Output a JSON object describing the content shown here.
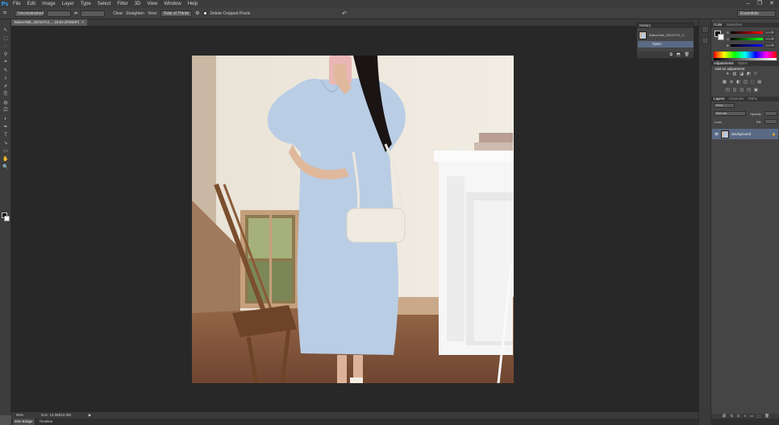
{
  "app": {
    "logo": "Ps"
  },
  "menu": [
    "File",
    "Edit",
    "Image",
    "Layer",
    "Type",
    "Select",
    "Filter",
    "3D",
    "View",
    "Window",
    "Help"
  ],
  "window_controls": {
    "minimize": "–",
    "restore": "❐",
    "close": "✕"
  },
  "options": {
    "tool_glyph": "⌗",
    "ratio_select": "Unconstrained",
    "swap_glyph": "⇄",
    "clear_label": "Clear",
    "straighten_label": "Straighten",
    "view_label": "View:",
    "view_select": "Rule of Thirds",
    "delete_cropped_label": "Delete Cropped Pixels",
    "reset_glyph": "↶",
    "workspace": "Essentials"
  },
  "document": {
    "tab_title": "BabosTalk_20210712_...18:04 (RGB/8*)",
    "tab_close": "×"
  },
  "tools": [
    "↖",
    "⬚",
    "◌",
    "⚲",
    "⌗",
    "✎",
    "⚕",
    "✐",
    "⎘",
    "◍",
    "⎚",
    "◐",
    "✒",
    "T",
    "↘",
    "▭",
    "✋",
    "🔍"
  ],
  "status": {
    "zoom": "50%",
    "doc": "Doc: 12.0M/12.0M",
    "arrow": "▶"
  },
  "bottom_tabs": [
    "Mini Bridge",
    "Timeline"
  ],
  "history": {
    "title": "History",
    "snapshot": "BabosTalk_20210712_1...",
    "step": "Open",
    "foot": [
      "⧉",
      "⬒",
      "🗑"
    ]
  },
  "color_panel": {
    "tabs": [
      "Color",
      "Swatches"
    ],
    "rows": [
      {
        "label": "R",
        "value": "0",
        "grad": "linear-gradient(90deg,#000,#f00)"
      },
      {
        "label": "G",
        "value": "0",
        "grad": "linear-gradient(90deg,#000,#0f0)"
      },
      {
        "label": "B",
        "value": "0",
        "grad": "linear-gradient(90deg,#000,#00f)"
      }
    ]
  },
  "adjustments": {
    "tabs": [
      "Adjustments",
      "Styles"
    ],
    "title": "Add an adjustment",
    "row1": [
      "☀",
      "▥",
      "◪",
      "◩",
      "▽"
    ],
    "row2": [
      "▦",
      "⚖",
      "◧",
      "◫",
      "⬚",
      "▤"
    ],
    "row3": [
      "◰",
      "◱",
      "◲",
      "◳",
      "▣"
    ]
  },
  "layers": {
    "tabs": [
      "Layers",
      "Channels",
      "Paths"
    ],
    "kind": "Kind",
    "blend": "Normal",
    "opacity_label": "Opacity:",
    "lock_label": "Lock:",
    "fill_label": "Fill:",
    "layer_name": "Background",
    "lock_icon": "🔒",
    "eye_icon": "👁",
    "foot": [
      "⛓",
      "fx",
      "◘",
      "◑",
      "▭",
      "⬚",
      "🗑"
    ]
  }
}
